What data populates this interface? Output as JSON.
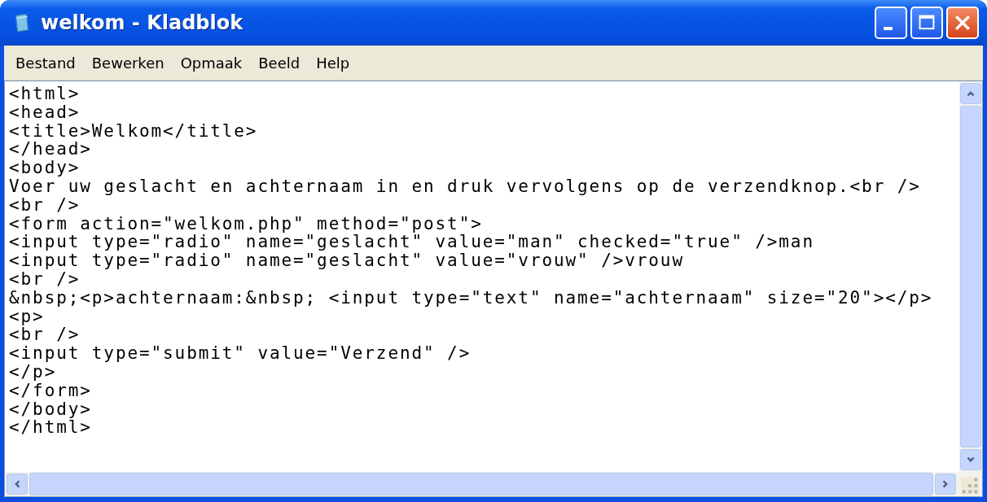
{
  "window": {
    "title": "welkom - Kladblok"
  },
  "menu": [
    "Bestand",
    "Bewerken",
    "Opmaak",
    "Beeld",
    "Help"
  ],
  "editor": {
    "lines": [
      "<html>",
      "<head>",
      "<title>Welkom</title>",
      "</head>",
      "<body>",
      "Voer uw geslacht en achternaam in en druk vervolgens op de verzendknop.<br />",
      "<br />",
      "<form action=\"welkom.php\" method=\"post\">",
      "<input type=\"radio\" name=\"geslacht\" value=\"man\" checked=\"true\" />man",
      "<input type=\"radio\" name=\"geslacht\" value=\"vrouw\" />vrouw",
      "<br />",
      "&nbsp;<p>achternaam:&nbsp; <input type=\"text\" name=\"achternaam\" size=\"20\"></p>",
      "<p>",
      "<br />",
      "<input type=\"submit\" value=\"Verzend\" />",
      "</p>",
      "</form>",
      "</body>",
      "</html>"
    ]
  }
}
